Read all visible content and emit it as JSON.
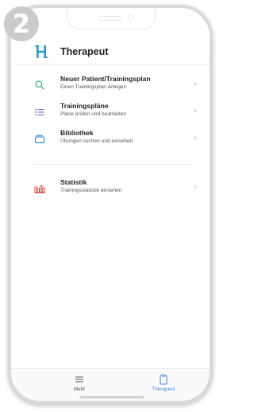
{
  "step_badge": "2",
  "header": {
    "title": "Therapeut",
    "logo_icon": "h-logo-icon"
  },
  "menu": [
    {
      "title": "Neuer Patient/Trainingsplan",
      "subtitle": "Einen Trainingsplan anlegen",
      "icon": "search-icon",
      "color": "#2eb872"
    },
    {
      "title": "Trainingspläne",
      "subtitle": "Pläne prüfen und bearbeiten",
      "icon": "list-icon",
      "color": "#6b5bd6"
    },
    {
      "title": "Bibliothek",
      "subtitle": "Übungen suchen und einsehen",
      "icon": "library-icon",
      "color": "#2e8fd9"
    },
    {
      "title": "Statistik",
      "subtitle": "Trainingsstatistik einsehen",
      "icon": "bar-chart-icon",
      "color": "#e0463f"
    }
  ],
  "tabbar": {
    "mehr": {
      "label": "Mehr",
      "icon": "hamburger-icon"
    },
    "therapeut": {
      "label": "Therapeut",
      "icon": "clipboard-icon",
      "active": true
    }
  },
  "colors": {
    "accent": "#3b88e6",
    "logo": "#1e9ad6"
  }
}
